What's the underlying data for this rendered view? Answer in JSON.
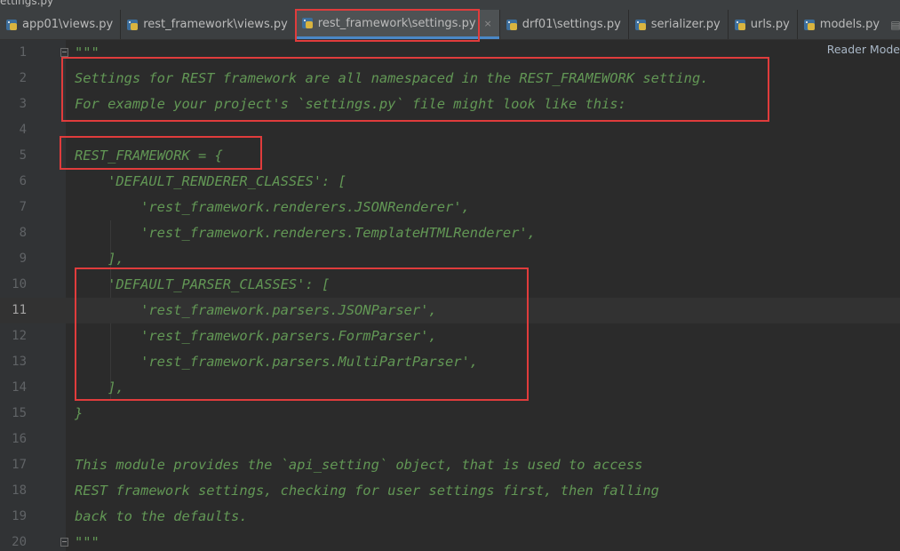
{
  "window_title": "ettings.py",
  "tabs": [
    {
      "label": "app01\\views.py",
      "active": false
    },
    {
      "label": "rest_framework\\views.py",
      "active": false
    },
    {
      "label": "rest_framework\\settings.py",
      "active": true,
      "close": "×"
    },
    {
      "label": "drf01\\settings.py",
      "active": false
    },
    {
      "label": "serializer.py",
      "active": false
    },
    {
      "label": "urls.py",
      "active": false
    },
    {
      "label": "models.py",
      "active": false
    }
  ],
  "reader_mode": "Reader Mode",
  "current_line": 11,
  "colors": {
    "docstring": "#629755",
    "highlight_box": "#e03c3c",
    "background": "#2b2b2b"
  },
  "lines": [
    {
      "n": "1",
      "text": "\"\"\""
    },
    {
      "n": "2",
      "text": "Settings for REST framework are all namespaced in the REST_FRAMEWORK setting."
    },
    {
      "n": "3",
      "text": "For example your project's `settings.py` file might look like this:"
    },
    {
      "n": "4",
      "text": ""
    },
    {
      "n": "5",
      "text": "REST_FRAMEWORK = {"
    },
    {
      "n": "6",
      "text": "    'DEFAULT_RENDERER_CLASSES': ["
    },
    {
      "n": "7",
      "text": "        'rest_framework.renderers.JSONRenderer',"
    },
    {
      "n": "8",
      "text": "        'rest_framework.renderers.TemplateHTMLRenderer',"
    },
    {
      "n": "9",
      "text": "    ],"
    },
    {
      "n": "10",
      "text": "    'DEFAULT_PARSER_CLASSES': ["
    },
    {
      "n": "11",
      "text": "        'rest_framework.parsers.JSONParser',"
    },
    {
      "n": "12",
      "text": "        'rest_framework.parsers.FormParser',"
    },
    {
      "n": "13",
      "text": "        'rest_framework.parsers.MultiPartParser',"
    },
    {
      "n": "14",
      "text": "    ],"
    },
    {
      "n": "15",
      "text": "}"
    },
    {
      "n": "16",
      "text": ""
    },
    {
      "n": "17",
      "text": "This module provides the `api_setting` object, that is used to access"
    },
    {
      "n": "18",
      "text": "REST framework settings, checking for user settings first, then falling"
    },
    {
      "n": "19",
      "text": "back to the defaults."
    },
    {
      "n": "20",
      "text": "\"\"\""
    }
  ]
}
